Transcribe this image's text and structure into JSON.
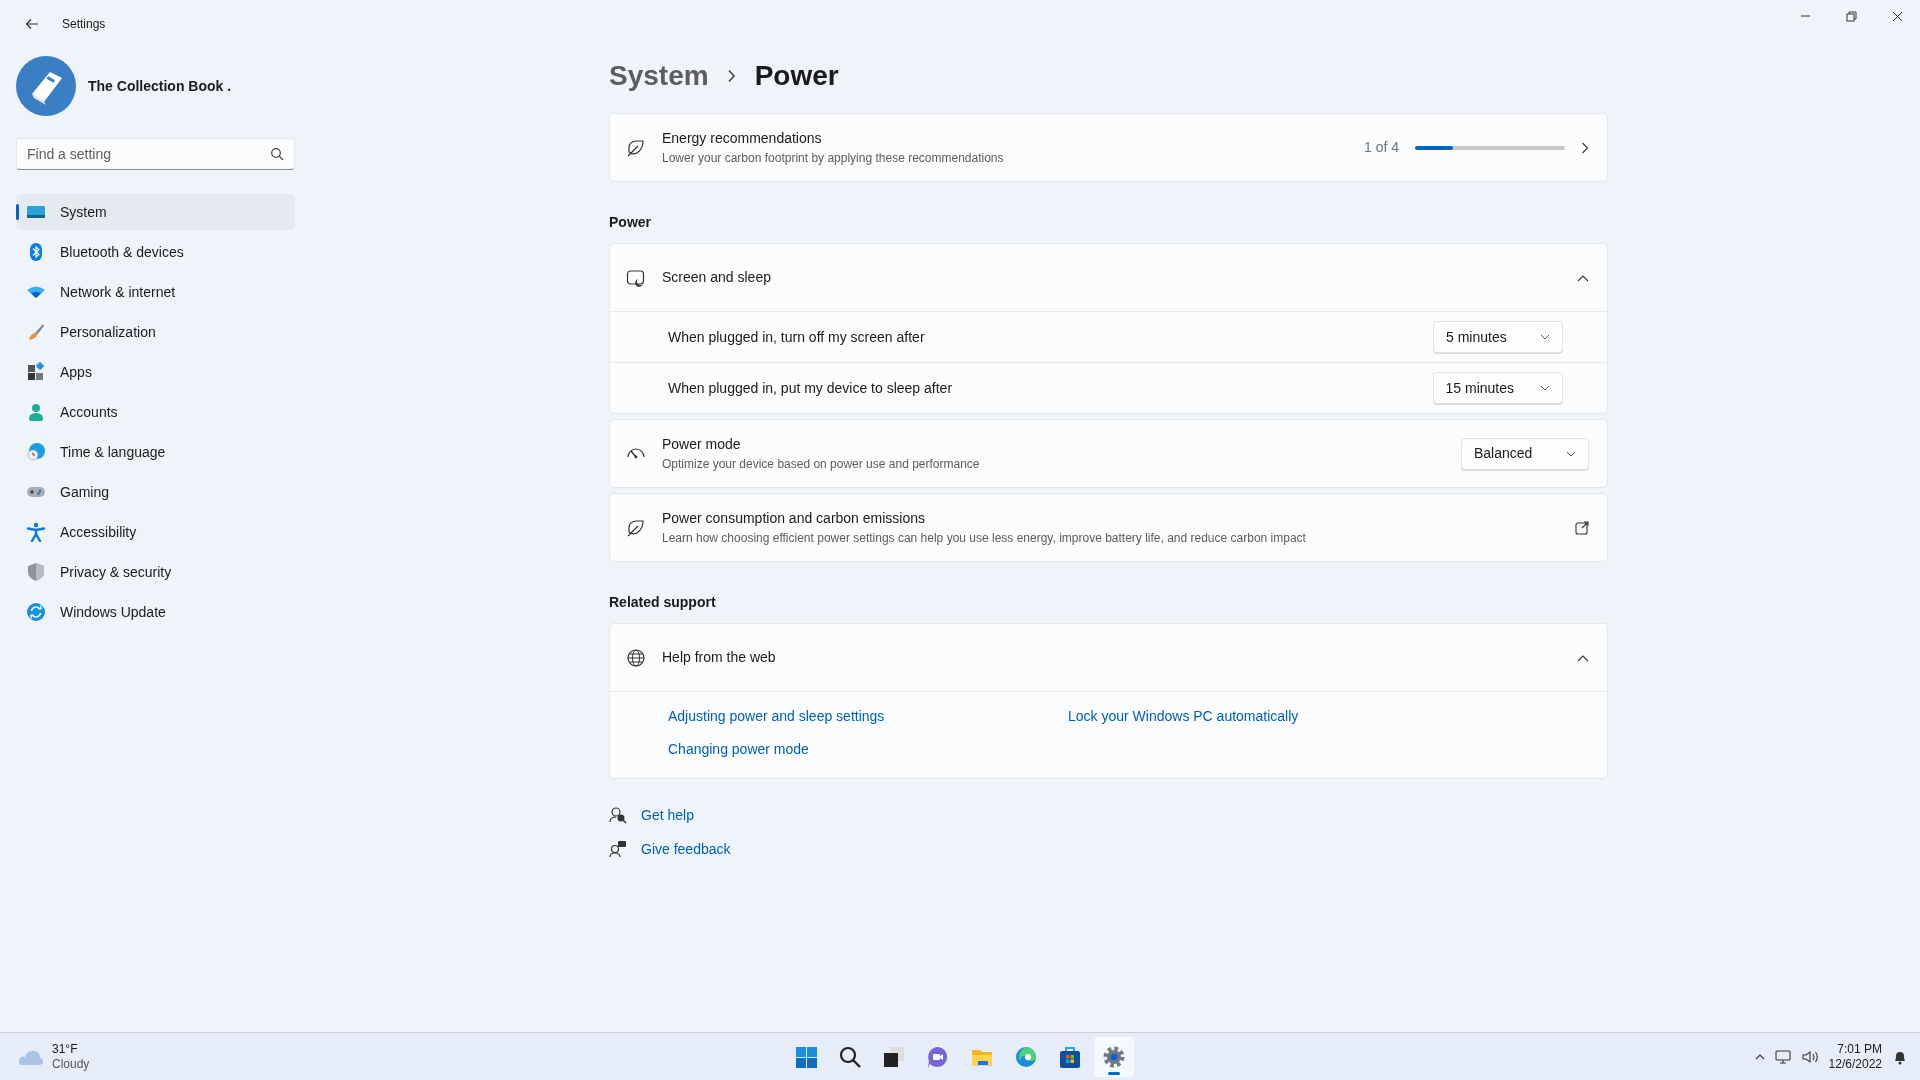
{
  "window": {
    "title": "Settings"
  },
  "account": {
    "name": "The Collection Book ."
  },
  "search": {
    "placeholder": "Find a setting"
  },
  "nav": [
    {
      "label": "System",
      "selected": true
    },
    {
      "label": "Bluetooth & devices",
      "selected": false
    },
    {
      "label": "Network & internet",
      "selected": false
    },
    {
      "label": "Personalization",
      "selected": false
    },
    {
      "label": "Apps",
      "selected": false
    },
    {
      "label": "Accounts",
      "selected": false
    },
    {
      "label": "Time & language",
      "selected": false
    },
    {
      "label": "Gaming",
      "selected": false
    },
    {
      "label": "Accessibility",
      "selected": false
    },
    {
      "label": "Privacy & security",
      "selected": false
    },
    {
      "label": "Windows Update",
      "selected": false
    }
  ],
  "breadcrumb": [
    {
      "label": "System",
      "current": false
    },
    {
      "label": "Power",
      "current": true
    }
  ],
  "energy": {
    "title": "Energy recommendations",
    "subtitle": "Lower your carbon footprint by applying these recommendations",
    "counter": "1 of 4",
    "level": 0.25
  },
  "power": {
    "heading": "Power",
    "screen_sleep": {
      "title": "Screen and sleep",
      "expanded": true,
      "rows": [
        {
          "label": "When plugged in, turn off my screen after",
          "value": "5 minutes"
        },
        {
          "label": "When plugged in, put my device to sleep after",
          "value": "15 minutes"
        }
      ]
    },
    "power_mode": {
      "title": "Power mode",
      "subtitle": "Optimize your device based on power use and performance",
      "value": "Balanced"
    },
    "consumption": {
      "title": "Power consumption and carbon emissions",
      "subtitle": "Learn how choosing efficient power settings can help you use less energy, improve battery life, and reduce carbon impact"
    }
  },
  "related": {
    "heading": "Related support",
    "help": {
      "title": "Help from the web",
      "expanded": true,
      "links": [
        "Adjusting power and sleep settings",
        "Lock your Windows PC automatically",
        "Changing power mode"
      ]
    }
  },
  "footer_links": [
    "Get help",
    "Give feedback"
  ],
  "taskbar": {
    "weather": {
      "temp": "31°F",
      "condition": "Cloudy"
    },
    "apps": [
      {
        "selected": false
      },
      {
        "selected": false
      },
      {
        "selected": false
      },
      {
        "selected": false
      },
      {
        "selected": false
      },
      {
        "selected": false
      },
      {
        "selected": false
      },
      {
        "selected": true
      }
    ],
    "clock": {
      "time": "7:01 PM",
      "date": "12/6/2022"
    }
  }
}
